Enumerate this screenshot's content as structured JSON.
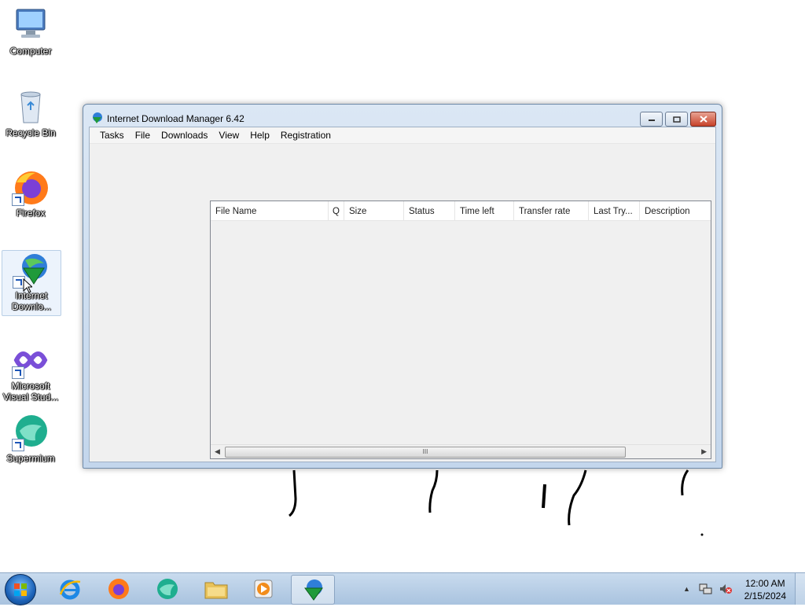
{
  "desktop": {
    "icons": [
      {
        "label": "Computer"
      },
      {
        "label": "Recycle Bin"
      },
      {
        "label": "Firefox"
      },
      {
        "label": "Internet Downlo..."
      },
      {
        "label": "Microsoft Visual Stud..."
      },
      {
        "label": "Supermium"
      }
    ]
  },
  "window": {
    "title": "Internet Download Manager 6.42",
    "menu": [
      "Tasks",
      "File",
      "Downloads",
      "View",
      "Help",
      "Registration"
    ],
    "columns": [
      "File Name",
      "Q",
      "Size",
      "Status",
      "Time left",
      "Transfer rate",
      "Last Try...",
      "Description"
    ],
    "scrollbar_grip": "III"
  },
  "taskbar": {
    "time": "12:00 AM",
    "date": "2/15/2024",
    "tray_arrow": "▲"
  },
  "colors": {
    "accent": "#1d63b8",
    "close": "#c7422a"
  }
}
